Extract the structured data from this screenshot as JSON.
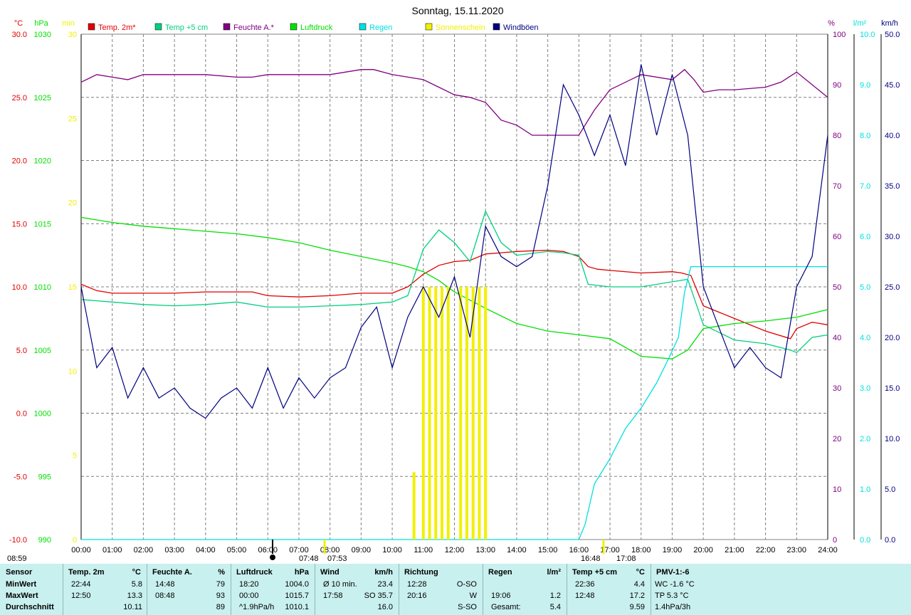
{
  "title": "Sonntag, 15.11.2020",
  "colors": {
    "temp2m": "#e00000",
    "temp5cm": "#00d080",
    "humidity": "#800080",
    "pressure": "#00e000",
    "rain": "#00e0e0",
    "sun": "#f0f000",
    "gusts": "#000080",
    "grid": "#808080",
    "stats_bg": "#c8f0ee"
  },
  "axes": {
    "temp": {
      "unit": "°C",
      "ticks": [
        "30.0",
        "25.0",
        "20.0",
        "15.0",
        "10.0",
        "5.0",
        "0.0",
        "-5.0",
        "-10.0"
      ]
    },
    "pressure": {
      "unit": "hPa",
      "ticks": [
        "1030",
        "1025",
        "1020",
        "1015",
        "1010",
        "1005",
        "1000",
        "995",
        "990"
      ]
    },
    "minutes": {
      "unit": "min",
      "ticks": [
        "30",
        "25",
        "20",
        "15",
        "10",
        "5",
        "0"
      ]
    },
    "humidity": {
      "unit": "%",
      "ticks": [
        "100",
        "90",
        "80",
        "70",
        "60",
        "50",
        "40",
        "30",
        "20",
        "10",
        "0"
      ]
    },
    "rain": {
      "unit": "l/m²",
      "ticks": [
        "10.0",
        "9.0",
        "8.0",
        "7.0",
        "6.0",
        "5.0",
        "4.0",
        "3.0",
        "2.0",
        "1.0",
        "0.0"
      ]
    },
    "wind": {
      "unit": "km/h",
      "ticks": [
        "50.0",
        "45.0",
        "40.0",
        "35.0",
        "30.0",
        "25.0",
        "20.0",
        "15.0",
        "10.0",
        "5.0",
        "0.0"
      ]
    },
    "x_ticks": [
      "00:00",
      "01:00",
      "02:00",
      "03:00",
      "04:00",
      "05:00",
      "06:00",
      "07:00",
      "08:00",
      "09:00",
      "10:00",
      "11:00",
      "12:00",
      "13:00",
      "14:00",
      "15:00",
      "16:00",
      "17:00",
      "18:00",
      "19:00",
      "20:00",
      "21:00",
      "22:00",
      "23:00",
      "24:00"
    ]
  },
  "markers": {
    "sun_left": "08:59",
    "sunrise_a": "07:48",
    "sunrise_b": "07:53",
    "sunset_a": "16:48",
    "sunset_b": "17:08"
  },
  "chart_data": {
    "type": "line",
    "title": "Sonntag, 15.11.2020",
    "x_unit": "hour",
    "xlim": [
      0,
      24
    ],
    "grid": true,
    "legend_position": "top",
    "series": [
      {
        "name": "Temp. 2m*",
        "axis": "temp",
        "color": "#e00000",
        "x": [
          0,
          0.5,
          1,
          1.5,
          2,
          3,
          4,
          5,
          5.5,
          6,
          7,
          8,
          9,
          9.5,
          10,
          10.5,
          11,
          11.5,
          12,
          12.5,
          13,
          13.5,
          14,
          15,
          15.5,
          16,
          16.3,
          16.6,
          17,
          18,
          19,
          19.3,
          19.6,
          20,
          20.5,
          21,
          22,
          22.8,
          23,
          23.5,
          24
        ],
        "values": [
          10.2,
          9.7,
          9.5,
          9.5,
          9.5,
          9.5,
          9.6,
          9.6,
          9.6,
          9.3,
          9.2,
          9.3,
          9.5,
          9.5,
          9.5,
          10.0,
          11.0,
          11.7,
          12.0,
          12.1,
          12.6,
          12.7,
          12.8,
          12.9,
          12.8,
          12.4,
          11.6,
          11.4,
          11.3,
          11.1,
          11.2,
          11.1,
          10.9,
          8.5,
          8.0,
          7.5,
          6.5,
          5.9,
          6.7,
          7.2,
          7.0
        ]
      },
      {
        "name": "Temp +5 cm",
        "axis": "temp",
        "color": "#00d080",
        "x": [
          0,
          1,
          2,
          3,
          4,
          5,
          6,
          7,
          8,
          9,
          10,
          10.5,
          11,
          11.5,
          12,
          12.5,
          13,
          13.5,
          14,
          15,
          15.5,
          16,
          16.3,
          17,
          18,
          19,
          19.5,
          20,
          21,
          22,
          22.8,
          23,
          23.5,
          24
        ],
        "values": [
          9.0,
          8.8,
          8.6,
          8.5,
          8.6,
          8.8,
          8.4,
          8.4,
          8.5,
          8.6,
          8.8,
          9.3,
          13.0,
          14.5,
          13.5,
          12.0,
          16.0,
          13.5,
          12.5,
          12.8,
          12.7,
          12.5,
          10.2,
          10.0,
          10.0,
          10.4,
          10.6,
          7.0,
          5.8,
          5.5,
          5.0,
          4.8,
          6.0,
          6.2
        ]
      },
      {
        "name": "Feuchte A.*",
        "axis": "humidity",
        "color": "#800080",
        "x": [
          0,
          0.5,
          1,
          1.5,
          2,
          3,
          4,
          5,
          5.5,
          6,
          7,
          8,
          9,
          9.4,
          10,
          11,
          11.5,
          12,
          12.5,
          13,
          13.5,
          14,
          14.5,
          15,
          15.5,
          16,
          16.5,
          17,
          18,
          19,
          19.4,
          19.7,
          20,
          20.5,
          21,
          22,
          22.5,
          23,
          23.5,
          24
        ],
        "values": [
          90.5,
          92,
          91.5,
          91,
          92,
          92,
          92,
          91.5,
          91.5,
          92,
          92,
          92,
          93,
          93,
          92,
          91,
          89.5,
          88,
          87.5,
          86.5,
          83,
          82,
          80,
          80,
          80,
          80,
          85,
          89,
          92,
          91,
          93,
          91,
          88.5,
          89,
          89,
          89.5,
          90.5,
          92.5,
          90,
          87.5
        ]
      },
      {
        "name": "Luftdruck",
        "axis": "pressure",
        "color": "#00e000",
        "x": [
          0,
          1,
          2,
          3,
          4,
          5,
          6,
          7,
          8,
          9,
          10,
          10.5,
          11,
          11.5,
          12,
          13,
          14,
          15,
          16,
          17,
          18,
          19,
          19.5,
          20,
          21,
          22,
          23,
          24
        ],
        "values": [
          1015.5,
          1015.1,
          1014.8,
          1014.6,
          1014.4,
          1014.2,
          1013.9,
          1013.5,
          1012.9,
          1012.4,
          1011.9,
          1011.6,
          1011.2,
          1010.5,
          1009.6,
          1008.3,
          1007.1,
          1006.5,
          1006.2,
          1005.9,
          1004.5,
          1004.3,
          1005.0,
          1006.7,
          1007.1,
          1007.3,
          1007.6,
          1008.2
        ]
      },
      {
        "name": "Regen",
        "axis": "rain",
        "color": "#00e0e0",
        "x": [
          0,
          16.0,
          16.2,
          16.5,
          17.0,
          17.5,
          18.0,
          18.5,
          18.9,
          19.2,
          19.4,
          19.6,
          19.9,
          20.5,
          22,
          23,
          24
        ],
        "values": [
          0,
          0,
          0.3,
          1.1,
          1.6,
          2.2,
          2.6,
          3.1,
          3.6,
          4.0,
          4.9,
          5.4,
          5.4,
          5.4,
          5.4,
          5.4,
          5.4
        ]
      },
      {
        "name": "Sonnenschein",
        "axis": "minutes",
        "color": "#f0f000",
        "x": [
          10.7,
          11.0,
          11.2,
          11.4,
          11.6,
          11.8,
          12.2,
          12.4,
          12.6,
          12.8,
          13.0
        ],
        "values": [
          4,
          15,
          15,
          15,
          15,
          15,
          15,
          15,
          15,
          15,
          15
        ]
      },
      {
        "name": "Windböen",
        "axis": "wind",
        "color": "#000080",
        "x": [
          0,
          0.5,
          1,
          1.5,
          2,
          2.5,
          3,
          3.5,
          4,
          4.5,
          5,
          5.5,
          6,
          6.5,
          7,
          7.5,
          8,
          8.5,
          9,
          9.5,
          10,
          10.5,
          11,
          11.5,
          12,
          12.5,
          13,
          13.5,
          14,
          14.5,
          15,
          15.5,
          16,
          16.5,
          17,
          17.5,
          18,
          18.5,
          19,
          19.5,
          20,
          20.5,
          21,
          21.5,
          22,
          22.5,
          23,
          23.5,
          24
        ],
        "values": [
          25,
          17,
          19,
          14,
          17,
          14,
          15,
          13,
          12,
          14,
          15,
          13,
          17,
          13,
          16,
          14,
          16,
          17,
          21,
          23,
          17,
          22,
          25,
          22,
          26,
          20,
          31,
          28,
          27,
          28,
          35,
          45,
          42,
          38,
          42,
          37,
          47,
          40,
          46,
          40,
          25,
          21,
          17,
          19,
          17,
          16,
          25,
          28,
          40
        ]
      }
    ]
  },
  "stats": {
    "sensor": {
      "header": "Sensor",
      "rows": [
        "MinWert",
        "MaxWert",
        "Durchschnitt"
      ]
    },
    "temp2m": {
      "header": "Temp. 2m",
      "unit": "°C",
      "rows": [
        [
          "22:44",
          "5.8"
        ],
        [
          "12:50",
          "13.3"
        ],
        [
          "",
          "10.11"
        ]
      ]
    },
    "humidity": {
      "header": "Feuchte A.",
      "unit": "%",
      "rows": [
        [
          "14:48",
          "79"
        ],
        [
          "08:48",
          "93"
        ],
        [
          "",
          "89"
        ]
      ]
    },
    "pressure": {
      "header": "Luftdruck",
      "unit": "hPa",
      "rows": [
        [
          "18:20",
          "1004.0"
        ],
        [
          "00:00",
          "1015.7"
        ],
        [
          "^1.9hPa/h",
          "1010.1"
        ]
      ]
    },
    "wind": {
      "header": "Wind",
      "unit": "km/h",
      "rows": [
        [
          "Ø 10 min.",
          "23.4"
        ],
        [
          "17:58",
          "SO 35.7"
        ],
        [
          "",
          "16.0"
        ]
      ]
    },
    "direction": {
      "header": "Richtung",
      "rows": [
        [
          "12:28",
          "O-SO"
        ],
        [
          "20:16",
          "W"
        ],
        [
          "",
          "S-SO"
        ]
      ]
    },
    "rain": {
      "header": "Regen",
      "unit": "l/m²",
      "rows": [
        [
          "",
          ""
        ],
        [
          "19:06",
          "1.2"
        ],
        [
          "Gesamt:",
          "5.4"
        ]
      ]
    },
    "temp5cm": {
      "header": "Temp +5 cm",
      "unit": "°C",
      "rows": [
        [
          "22:36",
          "4.4"
        ],
        [
          "12:48",
          "17.2"
        ],
        [
          "",
          "9.59"
        ]
      ]
    },
    "pmv": {
      "header": "PMV-1:-6",
      "rows": [
        "WC -1.6 °C",
        "TP 5.3 °C",
        "1.4hPa/3h"
      ]
    }
  }
}
